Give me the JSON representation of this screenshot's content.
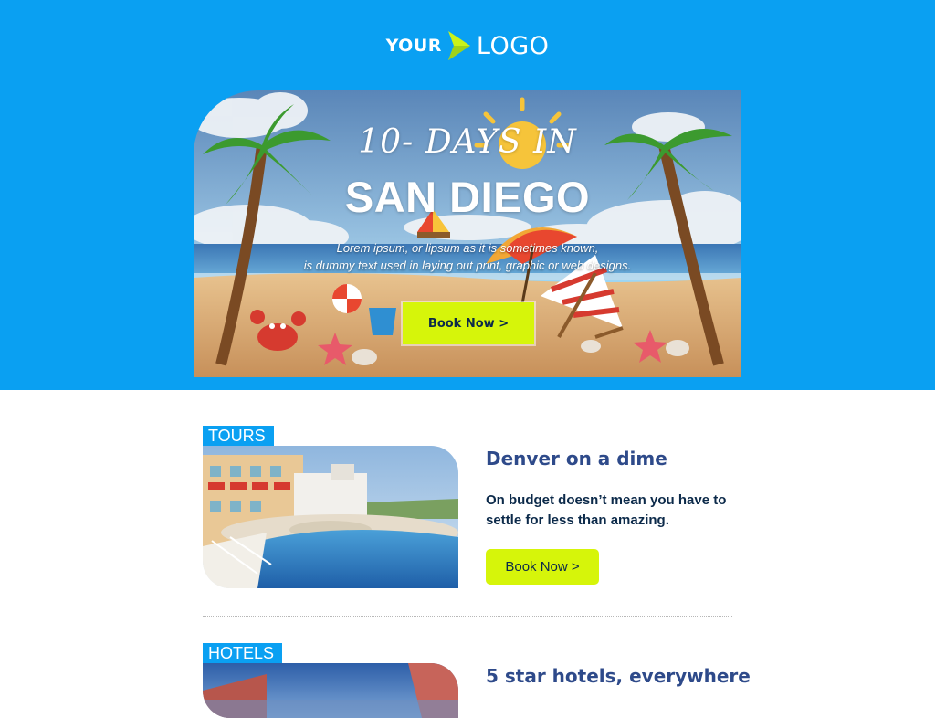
{
  "brand": {
    "logo_left": "YOUR",
    "logo_right": "LOGO"
  },
  "hero": {
    "title_line1": "10- DAYS IN",
    "title_line2": "SAN DIEGO",
    "desc_line1": "Lorem ipsum, or lipsum as it is sometimes known,",
    "desc_line2": "is dummy text used in laying out print, graphic or web designs.",
    "button_label": "Book Now >"
  },
  "cards": [
    {
      "tag": "TOURS",
      "title": "Denver on a dime",
      "text": "On budget doesn’t mean you have to settle for less than amazing.",
      "button_label": "Book Now >"
    },
    {
      "tag": "HOTELS",
      "title": "5 star hotels, everywhere"
    }
  ],
  "colors": {
    "brand_blue": "#0aa0f2",
    "accent_lime": "#d6f50a",
    "heading_navy": "#2e4a8a",
    "text_navy": "#0c2a4a"
  },
  "icons": {
    "logo_mark": "chevron-arrow-icon"
  }
}
